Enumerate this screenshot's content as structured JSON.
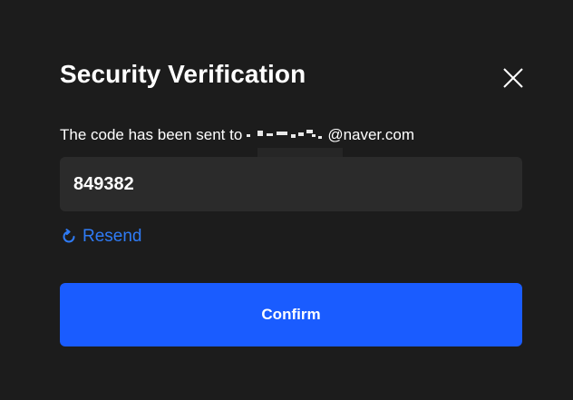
{
  "dialog": {
    "title": "Security Verification",
    "description_prefix": "The code has been sent to",
    "email_domain": "@naver.com",
    "code_value": "849382",
    "resend_label": "Resend",
    "confirm_label": "Confirm"
  },
  "icons": {
    "close": "close-icon",
    "resend": "refresh-icon"
  },
  "colors": {
    "background": "#1c1c1c",
    "input_background": "#2b2b2b",
    "accent": "#1a5cff",
    "link": "#2f7bf5",
    "text": "#ffffff"
  }
}
